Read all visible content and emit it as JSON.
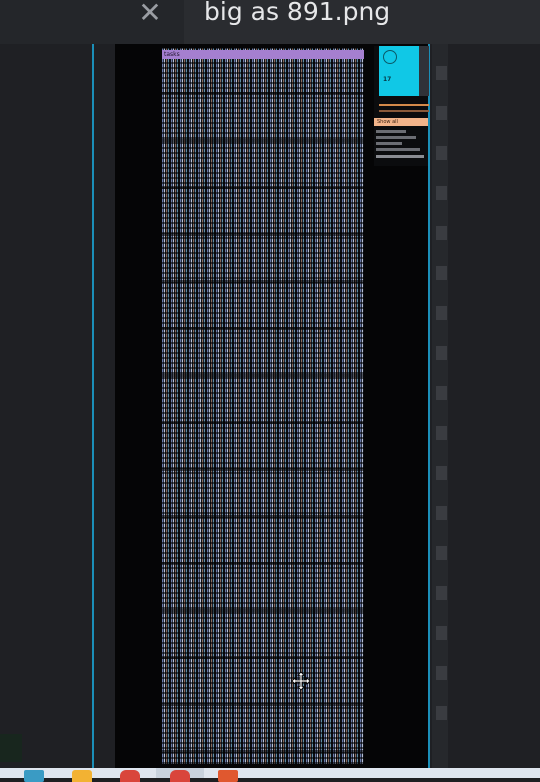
{
  "tab": {
    "close_glyph": "✕",
    "title": "big as 891.png"
  },
  "viewer": {
    "thumbnail_header_text": "tasks",
    "sidebar_card_text": "17",
    "orange_bar_text": "Show all"
  },
  "colors": {
    "accent_cyan": "#1b8fb8",
    "header_purple": "#a57fd0",
    "card_cyan": "#10c8e6",
    "bar_orange": "#f2b48a"
  },
  "icons": {
    "close": "close-icon",
    "cursor": "move-cursor-icon",
    "taskbar": [
      "file-explorer-icon",
      "folder-icon",
      "chrome-icon",
      "chrome-icon-2",
      "presentation-icon"
    ]
  }
}
